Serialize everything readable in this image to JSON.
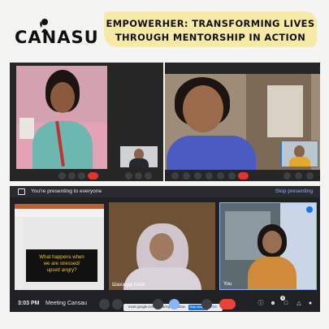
{
  "logo": {
    "text": "CANASU"
  },
  "banner": {
    "line1": "EMPOWERHER: TRANSFORMING LIVES",
    "line2": "THROUGH MENTORSHIP IN ACTION"
  },
  "meet": {
    "presenting_text": "You're presenting to everyone",
    "stop_presenting": "Stop presenting",
    "slide_text_1": "What happens when",
    "slide_text_2": "we are stressed/",
    "slide_text_3": "upset/ angry?",
    "participant_name": "Шахзода Кизи",
    "self_name": "You",
    "time": "3:03 PM",
    "meeting_name": "Meeting Cansau",
    "share_notice": "meet.google.com is sharing a window.",
    "stop_sharing": "Stop sharing",
    "hide": "Hide",
    "participants_count": "3"
  },
  "colors": {
    "banner": "#f7e9a6",
    "end_call": "#e0352b",
    "meet_dark": "#202124",
    "link_blue": "#8ab4f8"
  }
}
